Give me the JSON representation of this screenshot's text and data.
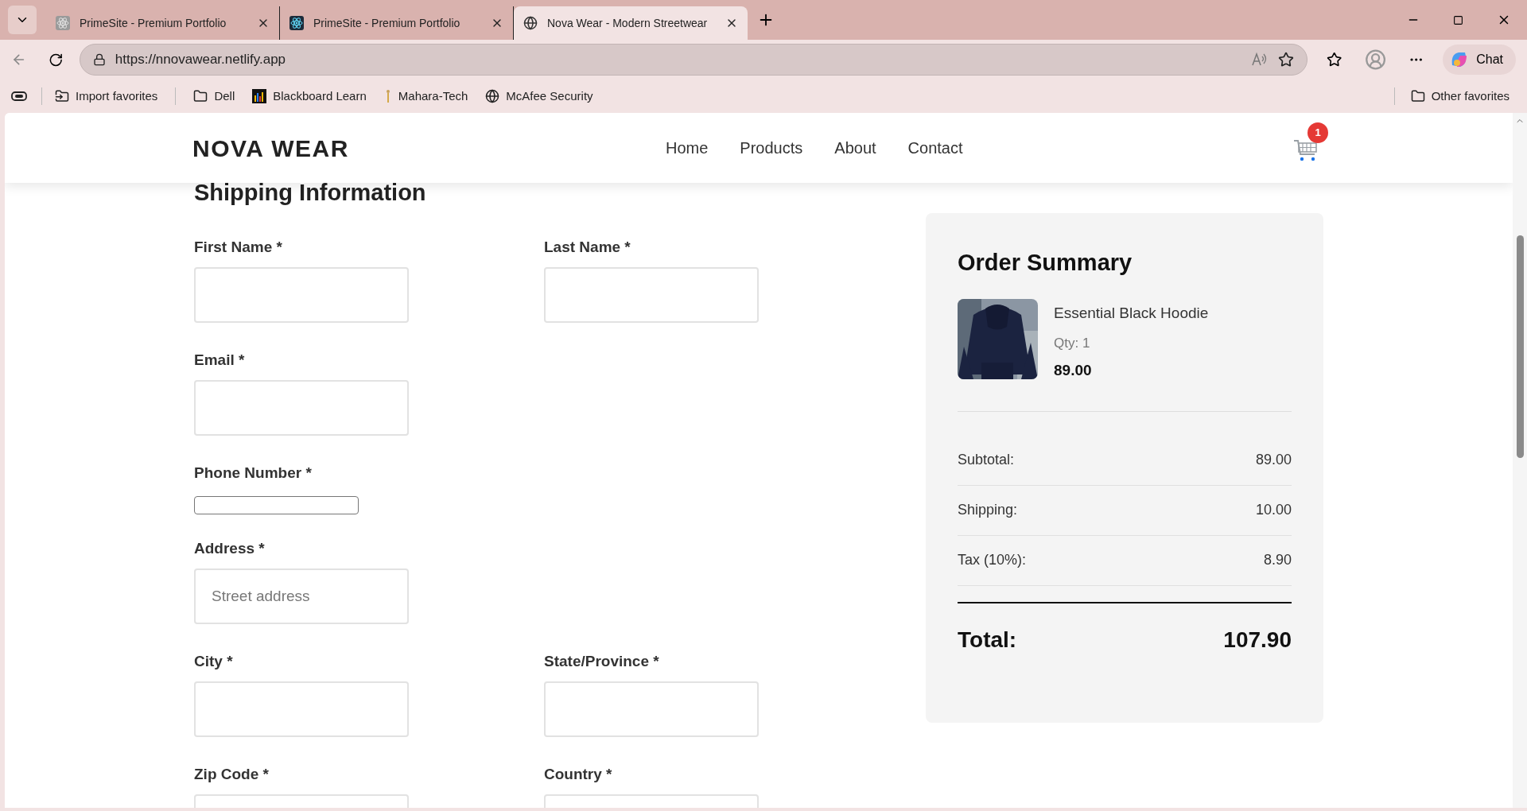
{
  "browser": {
    "tabs": [
      {
        "title": "PrimeSite - Premium Portfolio",
        "selected": false,
        "kind": "gray"
      },
      {
        "title": "PrimeSite - Premium Portfolio",
        "selected": false,
        "kind": "dark"
      },
      {
        "title": "Nova Wear - Modern Streetwear",
        "selected": true,
        "kind": "globe"
      }
    ],
    "address": "https://nnovawear.netlify.app",
    "chat": "Chat",
    "favorites": [
      {
        "label": "Import favorites",
        "kind": "import"
      },
      {
        "label": "Dell",
        "kind": "folder"
      },
      {
        "label": "Blackboard Learn",
        "kind": "bars"
      },
      {
        "label": "Mahara-Tech",
        "kind": "figure"
      },
      {
        "label": "McAfee Security",
        "kind": "globe"
      }
    ],
    "other_favorites": "Other favorites"
  },
  "site": {
    "logo": "NOVA WEAR",
    "nav": [
      {
        "label": "Home"
      },
      {
        "label": "Products"
      },
      {
        "label": "About"
      },
      {
        "label": "Contact"
      }
    ],
    "cart_count": "1"
  },
  "shipping": {
    "title": "Shipping Information",
    "rows": [
      [
        {
          "label": "First Name *",
          "kind": "box"
        },
        {
          "label": "Last Name *",
          "kind": "box"
        }
      ],
      [
        {
          "label": "Email *",
          "kind": "box"
        }
      ],
      [
        {
          "label": "Phone Number *",
          "kind": "plain"
        }
      ],
      [
        {
          "label": "Address *",
          "kind": "box",
          "placeholder": "Street address"
        }
      ],
      [
        {
          "label": "City *",
          "kind": "box"
        },
        {
          "label": "State/Province *",
          "kind": "box"
        }
      ],
      [
        {
          "label": "Zip Code *",
          "kind": "box"
        },
        {
          "label": "Country *",
          "kind": "box"
        }
      ]
    ]
  },
  "summary": {
    "title": "Order Summary",
    "item": {
      "name": "Essential Black Hoodie",
      "qty": "Qty: 1",
      "price": "89.00"
    },
    "rows": [
      {
        "label": "Subtotal:",
        "value": "89.00"
      },
      {
        "label": "Shipping:",
        "value": "10.00"
      },
      {
        "label": "Tax (10%):",
        "value": "8.90"
      }
    ],
    "total": {
      "label": "Total:",
      "value": "107.90"
    }
  }
}
